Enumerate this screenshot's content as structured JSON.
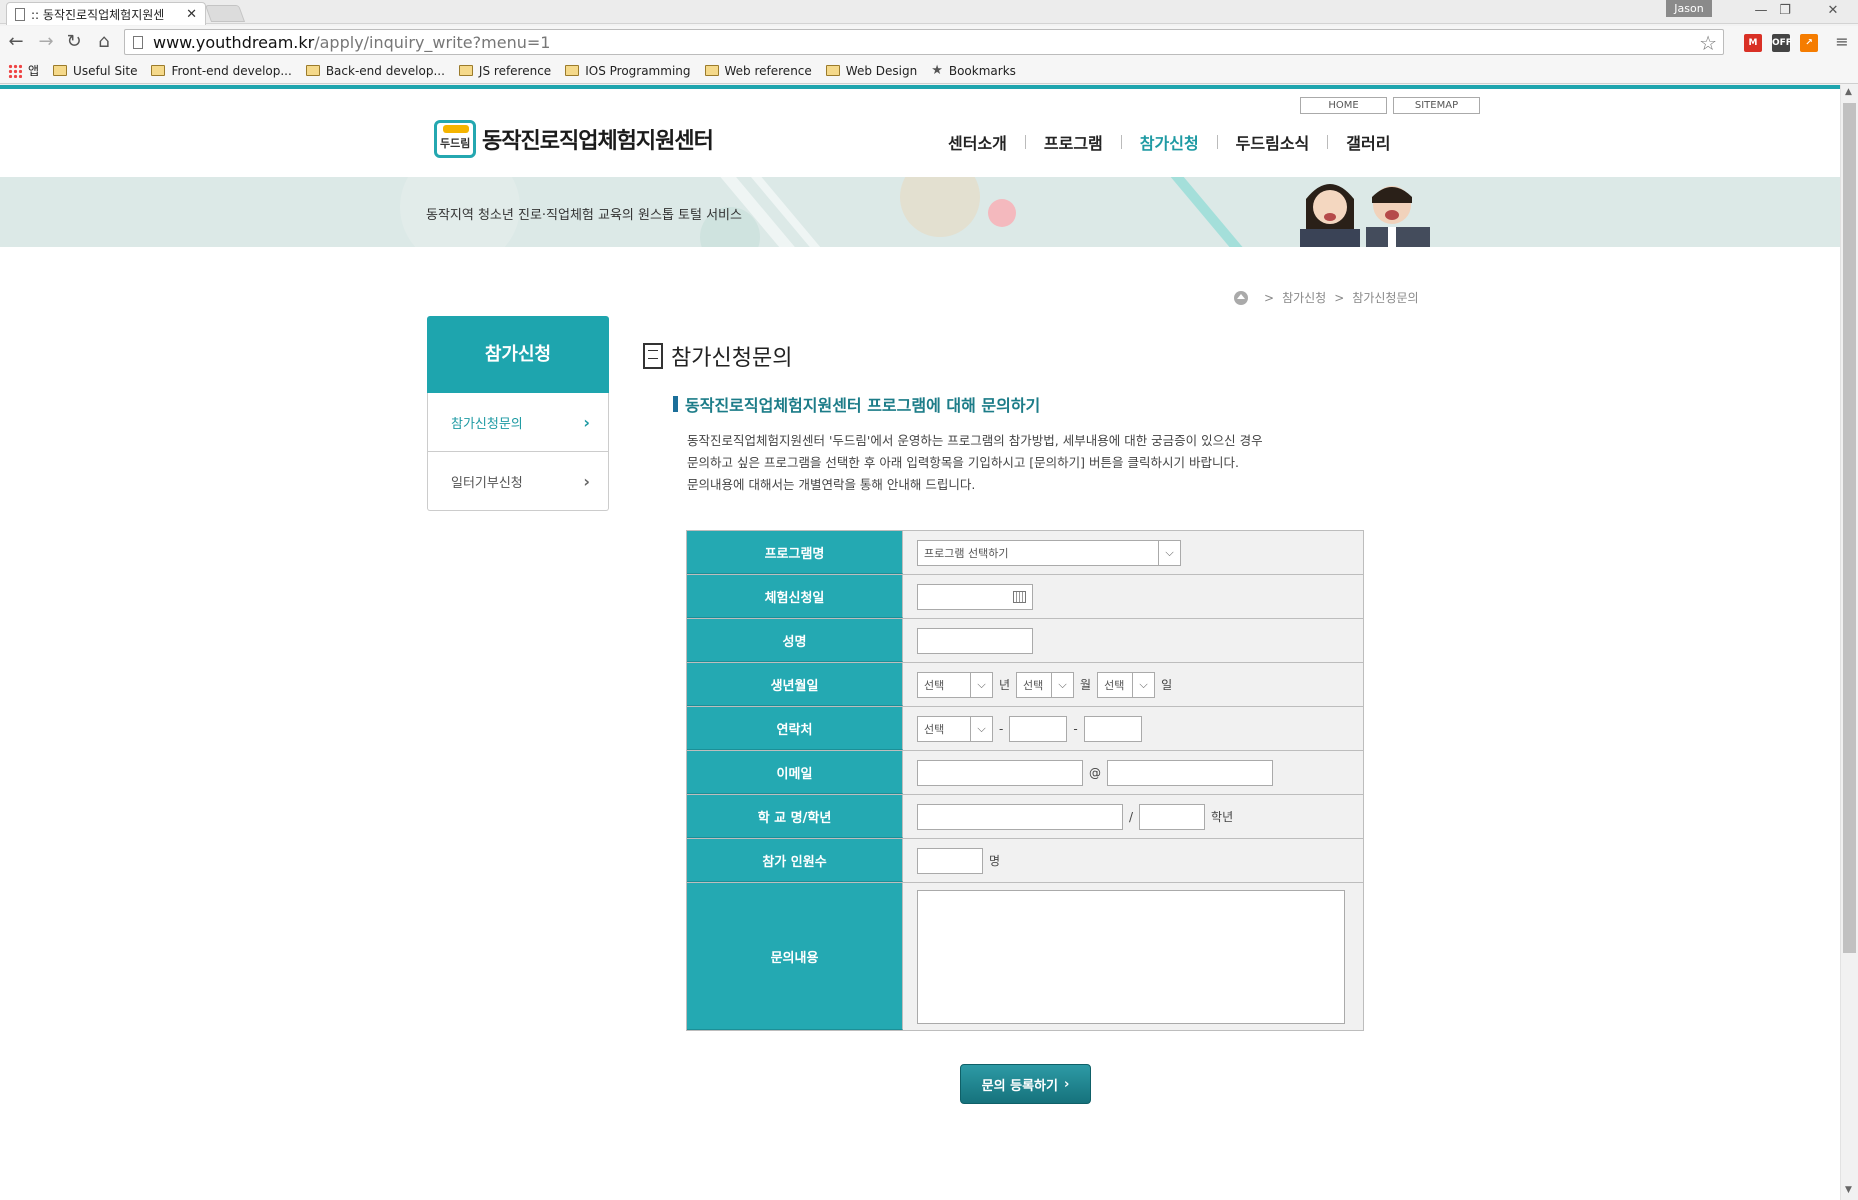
{
  "browser": {
    "tab_title": ":: 동작진로직업체험지원센",
    "tab_close": "✕",
    "user_badge": "Jason",
    "url_host": "www.youthdream.kr",
    "url_path": "/apply/inquiry_write?menu=1",
    "bookmarks": [
      {
        "label": "앱",
        "icon": "apps-icon"
      },
      {
        "label": "Useful Site",
        "icon": "folder-icon"
      },
      {
        "label": "Front-end develop...",
        "icon": "folder-icon"
      },
      {
        "label": "Back-end develop...",
        "icon": "folder-icon"
      },
      {
        "label": "JS reference",
        "icon": "folder-icon"
      },
      {
        "label": "IOS Programming",
        "icon": "folder-icon"
      },
      {
        "label": "Web reference",
        "icon": "folder-icon"
      },
      {
        "label": "Web Design",
        "icon": "folder-icon"
      },
      {
        "label": "Bookmarks",
        "icon": "star-icon"
      }
    ],
    "extensions": [
      {
        "name": "gmail-icon",
        "glyph": "M",
        "color": "#d93025"
      },
      {
        "name": "off-extension-icon",
        "glyph": "OFF",
        "color": "#444444"
      },
      {
        "name": "analytics-extension-icon",
        "glyph": "↗",
        "color": "#f57c00"
      }
    ]
  },
  "site": {
    "util_links": {
      "home": "HOME",
      "sitemap": "SITEMAP"
    },
    "logo_mark": "두드림",
    "logo_text": "동작진로직업체험지원센터",
    "gnb": [
      "센터소개",
      "프로그램",
      "참가신청",
      "두드림소식",
      "갤러리"
    ],
    "gnb_active_index": 2,
    "banner_text": "동작지역 청소년 진로·직업체험 교육의 원스톱 토털 서비스",
    "accent_color": "#1ea5ae"
  },
  "breadcrumb": {
    "items": [
      "참가신청",
      "참가신청문의"
    ],
    "separator": ">"
  },
  "lnb": {
    "title": "참가신청",
    "items": [
      {
        "label": "참가신청문의",
        "active": true
      },
      {
        "label": "일터기부신청",
        "active": false
      }
    ],
    "chevron": "›"
  },
  "content": {
    "title": "참가신청문의",
    "subheading": "동작진로직업체험지원센터 프로그램에 대해 문의하기",
    "description": [
      "동작진로직업체험지원센터 '두드림'에서 운영하는 프로그램의 참가방법, 세부내용에 대한 궁금증이 있으신 경우",
      "문의하고 싶은 프로그램을 선택한 후 아래 입력항목을 기입하시고 [문의하기] 버튼을 클릭하시기 바랍니다.",
      "문의내용에 대해서는 개별연락을 통해 안내해 드립니다."
    ]
  },
  "form": {
    "labels": {
      "program": "프로그램명",
      "date": "체험신청일",
      "name": "성명",
      "birth": "생년월일",
      "phone": "연락처",
      "email": "이메일",
      "school": "학 교 명/학년",
      "count": "참가 인원수",
      "content": "문의내용"
    },
    "program_select": "프로그램 선택하기",
    "select_placeholder": "선택",
    "birth_units": {
      "year": "년",
      "month": "월",
      "day": "일"
    },
    "phone_sep": "-",
    "email_at": "@",
    "school_sep": "/",
    "grade_unit": "학년",
    "count_unit": "명",
    "dropdown_glyph": "⌵"
  },
  "submit": {
    "label": "문의 등록하기",
    "arrow": "›"
  }
}
